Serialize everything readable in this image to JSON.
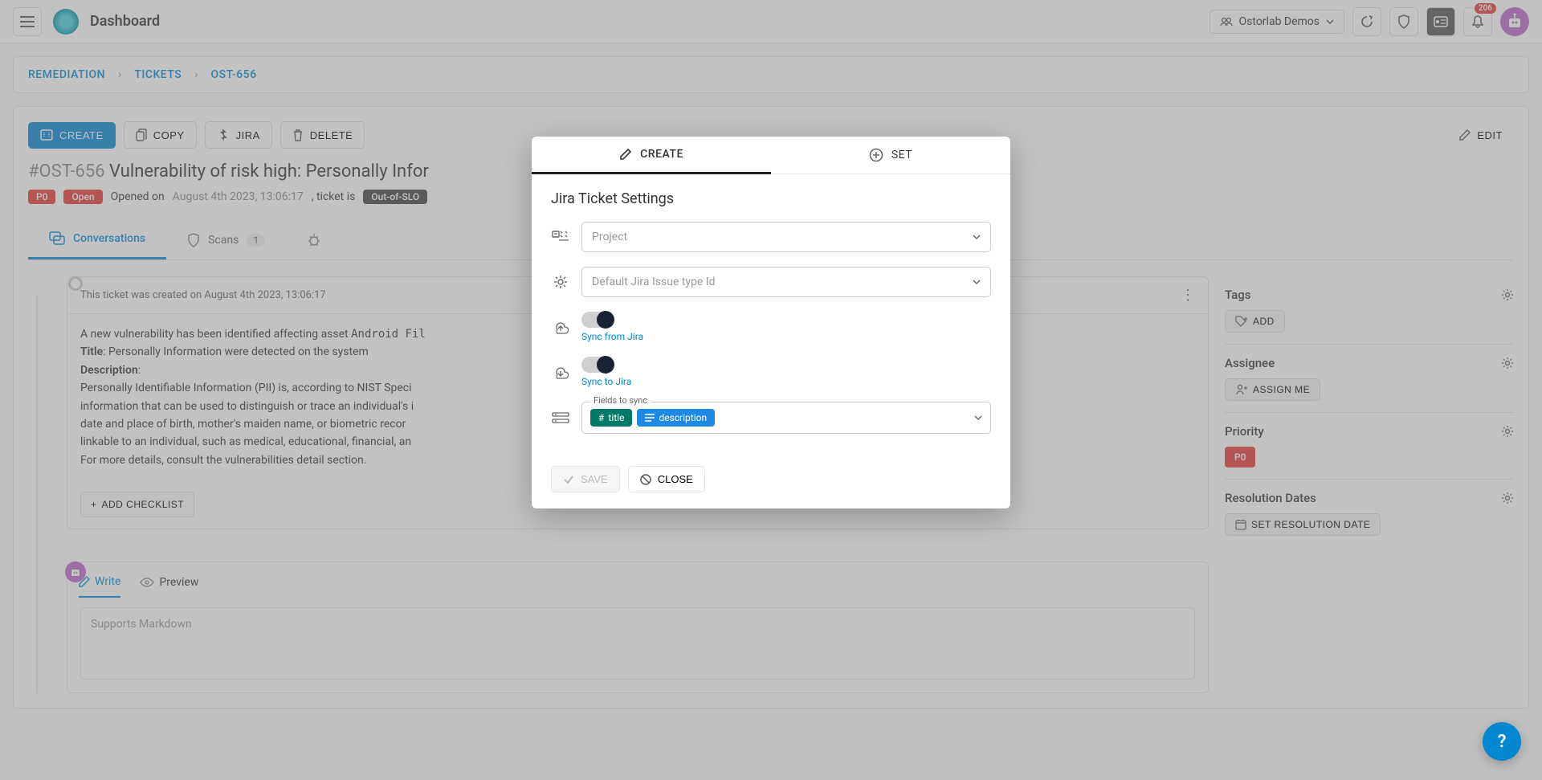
{
  "header": {
    "title": "Dashboard",
    "org": "Ostorlab Demos",
    "notif_count": "206"
  },
  "breadcrumb": [
    "REMEDIATION",
    "TICKETS",
    "OST-656"
  ],
  "actions": {
    "create": "CREATE",
    "copy": "COPY",
    "jira": "JIRA",
    "delete": "DELETE",
    "edit": "EDIT"
  },
  "ticket": {
    "id": "#OST-656",
    "title": "Vulnerability of risk high: Personally Infor",
    "p0": "P0",
    "open": "Open",
    "opened_on_label": "Opened on",
    "opened_on": "August 4th 2023, 13:06:17",
    "ticket_is": ", ticket is",
    "slo": "Out-of-SLO"
  },
  "tabs": {
    "conversations": "Conversations",
    "scans": "Scans",
    "scans_count": "1"
  },
  "conversation": {
    "created_text": "This ticket was created on August 4th 2023, 13:06:17",
    "line1a": "A new vulnerability has been identified affecting asset ",
    "line1b": "Android Fil",
    "title_label": "Title",
    "title_text": ": Personally Information were detected on the system",
    "desc_label": "Description",
    "desc1": "Personally Identifiable Information (PII) is, according to NIST Speci",
    "desc2": "information that can be used to distinguish or trace an individual's i",
    "desc3": "date and place of birth, mother's maiden name, or biometric recor",
    "desc4": "linkable to an individual, such as medical, educational, financial, an",
    "desc5": "For more details, consult the vulnerabilities detail section.",
    "add_checklist": "ADD CHECKLIST"
  },
  "write": {
    "write": "Write",
    "preview": "Preview",
    "placeholder": "Supports Markdown"
  },
  "sidebar": {
    "tags": "Tags",
    "add": "ADD",
    "assignee": "Assignee",
    "assign_me": "ASSIGN ME",
    "priority": "Priority",
    "p0": "P0",
    "resolution": "Resolution Dates",
    "set_resolution": "SET RESOLUTION DATE"
  },
  "modal": {
    "tab_create": "CREATE",
    "tab_set": "SET",
    "title": "Jira Ticket Settings",
    "project_placeholder": "Project",
    "issue_type_placeholder": "Default Jira Issue type Id",
    "sync_from": "Sync from Jira",
    "sync_to": "Sync to Jira",
    "fields_label": "Fields to sync",
    "field_title": "title",
    "field_desc": "description",
    "save": "SAVE",
    "close": "CLOSE"
  }
}
